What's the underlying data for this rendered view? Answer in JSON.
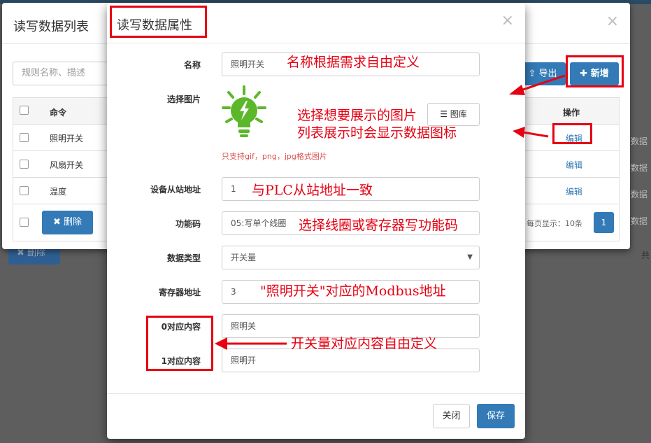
{
  "background": {
    "delete_label": "删除",
    "right_text": "共"
  },
  "list_modal": {
    "title": "读写数据列表",
    "close_glyph": "×",
    "search_placeholder": "规则名称、描述",
    "export_label": "导出",
    "add_label": "新增",
    "columns": {
      "command": "命令",
      "operation": "操作"
    },
    "rows": [
      {
        "name": "照明开关",
        "edit": "编辑"
      },
      {
        "name": "风扇开关",
        "edit": "编辑"
      },
      {
        "name": "温度",
        "edit": "编辑"
      }
    ],
    "delete_label": "删除",
    "per_page": "每页显示：10条",
    "page": "1",
    "right_edge": "数据"
  },
  "form_modal": {
    "title": "读写数据属性",
    "close_glyph": "×",
    "fields": {
      "name": {
        "label": "名称",
        "value": "照明开关"
      },
      "image": {
        "label": "选择图片",
        "gallery_label": "图库",
        "hint": "只支持gif，png，jpg格式图片"
      },
      "slave": {
        "label": "设备从站地址",
        "value": "1"
      },
      "func": {
        "label": "功能码",
        "value": "05:写单个线圈"
      },
      "dtype": {
        "label": "数据类型",
        "value": "开关量"
      },
      "reg": {
        "label": "寄存器地址",
        "value": "3"
      },
      "zero": {
        "label": "0对应内容",
        "value": "照明关"
      },
      "one": {
        "label": "1对应内容",
        "value": "照明开"
      }
    },
    "close_label": "关闭",
    "save_label": "保存"
  },
  "annotations": {
    "name": "名称根据需求自由定义",
    "image_line1": "选择想要展示的图片",
    "image_line2": "列表展示时会显示数据图标",
    "slave": "与PLC从站地址一致",
    "func": "选择线圈或寄存器写功能码",
    "reg": "\"照明开关\"对应的Modbus地址",
    "content": "开关量对应内容自由定义"
  },
  "colors": {
    "primary": "#337ab7",
    "annotation_red": "#e60012",
    "bulb_green": "#5cb82a"
  },
  "icons": [
    "plus-icon",
    "export-icon",
    "close-x-icon",
    "database-icon",
    "lightbulb-icon",
    "caret-down-icon"
  ]
}
